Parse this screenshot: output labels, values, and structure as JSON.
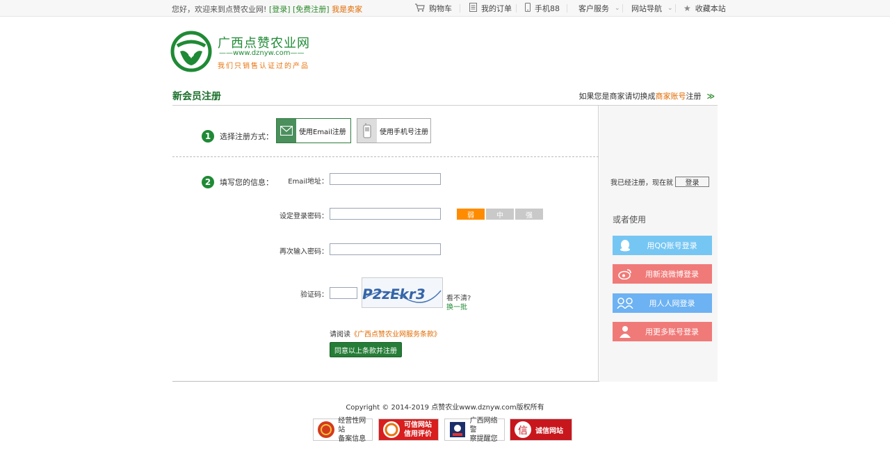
{
  "topbar": {
    "welcome": "您好，欢迎来到点赞农业网!",
    "login": "[登录]",
    "register": "[免费注册]",
    "seller": "我是卖家",
    "cart": "购物车",
    "orders": "我的订单",
    "mobile": "手机88",
    "service": "客户服务",
    "sitenav": "网站导航",
    "favorite": "收藏本站"
  },
  "logo": {
    "name": "广西点赞农业网",
    "url": "——www.dznyw.com——",
    "slogan": "我们只销售认证过的产品"
  },
  "pagehead": {
    "title": "新会员注册",
    "switch_prefix": "如果您是商家请切换成",
    "switch_link": "商家账号",
    "switch_suffix": "注册",
    "switch_arrow": "≫"
  },
  "step1": {
    "num": "1",
    "label": "选择注册方式：",
    "email_btn": "使用Email注册",
    "phone_btn": "使用手机号注册"
  },
  "step2": {
    "num": "2",
    "label": "填写您的信息："
  },
  "form": {
    "email_label": "Email地址：",
    "password_label": "设定登录密码：",
    "confirm_label": "再次输入密码：",
    "captcha_label": "验证码：",
    "captcha_text": "P2zEkr3",
    "cant_see": "看不清?",
    "refresh": "换一批",
    "strength": [
      "弱",
      "中",
      "强"
    ]
  },
  "agree": {
    "prefix": "请阅读",
    "link": "《广西点赞农业网服务条款》",
    "button": "同意以上条款并注册"
  },
  "side": {
    "already": "我已经注册，现在就",
    "login_btn": "登录",
    "or_use": "或者使用",
    "qq": "用QQ账号登录",
    "weibo": "用新浪微博登录",
    "renren": "用人人网登录",
    "more": "用更多账号登录"
  },
  "colors": {
    "qq": "#76c6f3",
    "weibo": "#f07a78",
    "renren": "#6db2f2",
    "more": "#f07a78",
    "brand": "#1f8a35"
  },
  "footer": {
    "copyright": "Copyright © 2014-2019 点赞农业www.dznyw.com版权所有",
    "badge1": [
      "经营性网站",
      "备案信息"
    ],
    "badge2": [
      "可信网站",
      "信用评价"
    ],
    "badge3": [
      "广西网络警",
      "察提醒您"
    ],
    "badge4": [
      "诚信网站"
    ]
  }
}
